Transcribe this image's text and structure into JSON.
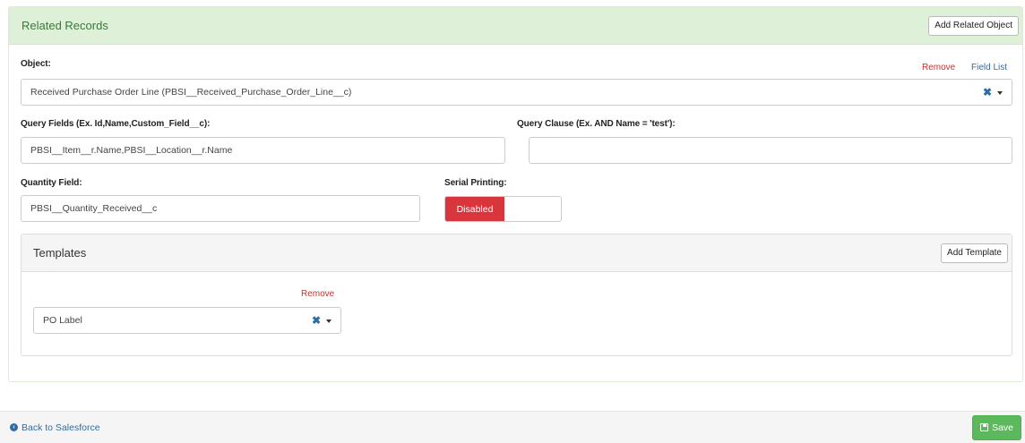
{
  "panel": {
    "title": "Related Records",
    "add_related_label": "Add Related Object"
  },
  "object": {
    "label": "Object:",
    "remove_label": "Remove",
    "field_list_label": "Field List",
    "value": "Received Purchase Order Line (PBSI__Received_Purchase_Order_Line__c)"
  },
  "query_fields": {
    "label": "Query Fields (Ex. Id,Name,Custom_Field__c):",
    "value": "PBSI__Item__r.Name,PBSI__Location__r.Name"
  },
  "query_clause": {
    "label": "Query Clause (Ex. AND Name = 'test'):",
    "value": ""
  },
  "quantity_field": {
    "label": "Quantity Field:",
    "value": "PBSI__Quantity_Received__c"
  },
  "serial_printing": {
    "label": "Serial Printing:",
    "state_label": "Disabled"
  },
  "templates": {
    "title": "Templates",
    "add_label": "Add Template",
    "items": [
      {
        "remove_label": "Remove",
        "value": "PO Label"
      }
    ]
  },
  "footer": {
    "back_label": "Back to Salesforce",
    "save_label": "Save"
  },
  "colors": {
    "panel_header": "#dff0d8",
    "panel_title": "#3c763d",
    "remove": "#c9302c",
    "link": "#2f6ca5",
    "toggle_disabled": "#d9353c",
    "save": "#5cb85c"
  }
}
